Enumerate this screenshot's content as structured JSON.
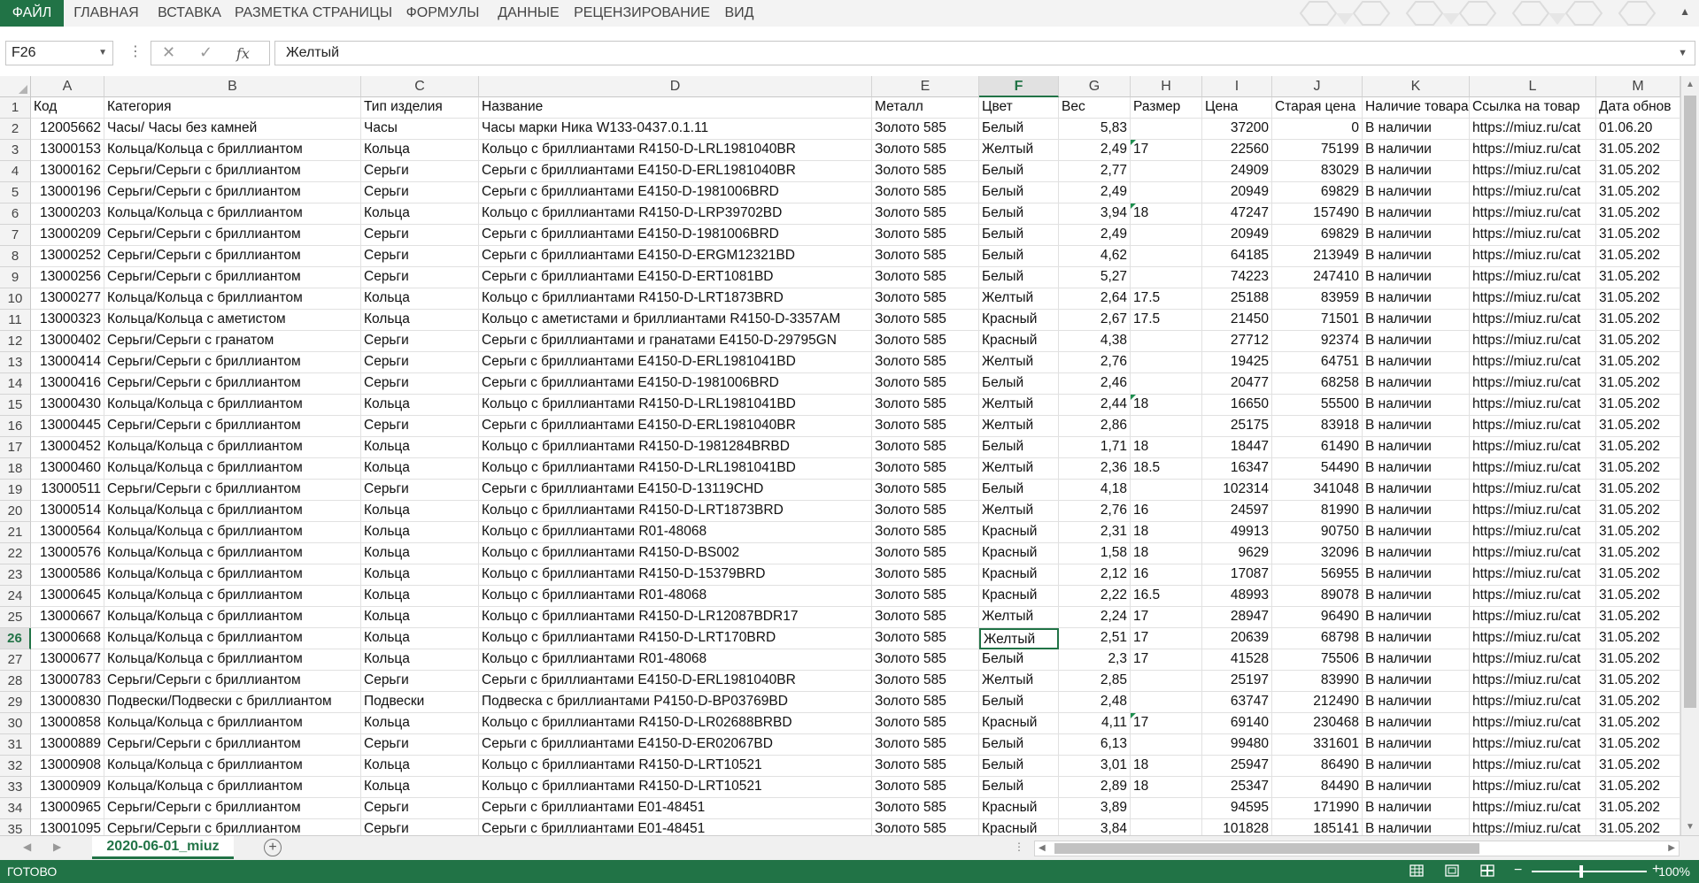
{
  "ribbon": {
    "tabs": [
      "ФАЙЛ",
      "ГЛАВНАЯ",
      "ВСТАВКА",
      "РАЗМЕТКА СТРАНИЦЫ",
      "ФОРМУЛЫ",
      "ДАННЫЕ",
      "РЕЦЕНЗИРОВАНИЕ",
      "ВИД"
    ]
  },
  "formula_bar": {
    "name_box": "F26",
    "fx_label": "fx",
    "content": "Желтый"
  },
  "grid": {
    "columns": [
      "A",
      "B",
      "C",
      "D",
      "E",
      "F",
      "G",
      "H",
      "I",
      "J",
      "K",
      "L",
      "M"
    ],
    "active_column": "F",
    "active_row": 26,
    "rows": [
      {
        "n": "1",
        "cells": [
          "Код",
          "Категория",
          "Тип изделия",
          "Название",
          "Металл",
          "Цвет",
          "Вес",
          "Размер",
          "Цена",
          "Старая цена",
          "Наличие товара",
          "Ссылка на товар",
          "Дата обнов"
        ]
      },
      {
        "n": "2",
        "cells": [
          "12005662",
          "Часы/ Часы без камней",
          "Часы",
          "Часы марки Ника W133-0437.0.1.11",
          "Золото 585",
          "Белый",
          "5,83",
          "",
          "37200",
          "0",
          "В наличии",
          "https://miuz.ru/cat",
          "01.06.20"
        ]
      },
      {
        "n": "3",
        "cells": [
          "13000153",
          "Кольца/Кольца с бриллиантом",
          "Кольца",
          "Кольцо с бриллиантами R4150-D-LRL1981040BR",
          "Золото 585",
          "Желтый",
          "2,49",
          "17",
          "22560",
          "75199",
          "В наличии",
          "https://miuz.ru/cat",
          "31.05.202"
        ]
      },
      {
        "n": "4",
        "cells": [
          "13000162",
          "Серьги/Серьги с бриллиантом",
          "Серьги",
          "Серьги с бриллиантами E4150-D-ERL1981040BR",
          "Золото 585",
          "Белый",
          "2,77",
          "",
          "24909",
          "83029",
          "В наличии",
          "https://miuz.ru/cat",
          "31.05.202"
        ]
      },
      {
        "n": "5",
        "cells": [
          "13000196",
          "Серьги/Серьги с бриллиантом",
          "Серьги",
          "Серьги с бриллиантами E4150-D-1981006BRD",
          "Золото 585",
          "Белый",
          "2,49",
          "",
          "20949",
          "69829",
          "В наличии",
          "https://miuz.ru/cat",
          "31.05.202"
        ]
      },
      {
        "n": "6",
        "cells": [
          "13000203",
          "Кольца/Кольца с бриллиантом",
          "Кольца",
          "Кольцо с бриллиантами R4150-D-LRP39702BD",
          "Золото 585",
          "Белый",
          "3,94",
          "18",
          "47247",
          "157490",
          "В наличии",
          "https://miuz.ru/cat",
          "31.05.202"
        ]
      },
      {
        "n": "7",
        "cells": [
          "13000209",
          "Серьги/Серьги с бриллиантом",
          "Серьги",
          "Серьги с бриллиантами E4150-D-1981006BRD",
          "Золото 585",
          "Белый",
          "2,49",
          "",
          "20949",
          "69829",
          "В наличии",
          "https://miuz.ru/cat",
          "31.05.202"
        ]
      },
      {
        "n": "8",
        "cells": [
          "13000252",
          "Серьги/Серьги с бриллиантом",
          "Серьги",
          "Серьги с бриллиантами E4150-D-ERGM12321BD",
          "Золото 585",
          "Белый",
          "4,62",
          "",
          "64185",
          "213949",
          "В наличии",
          "https://miuz.ru/cat",
          "31.05.202"
        ]
      },
      {
        "n": "9",
        "cells": [
          "13000256",
          "Серьги/Серьги с бриллиантом",
          "Серьги",
          "Серьги с бриллиантами E4150-D-ERT1081BD",
          "Золото 585",
          "Белый",
          "5,27",
          "",
          "74223",
          "247410",
          "В наличии",
          "https://miuz.ru/cat",
          "31.05.202"
        ]
      },
      {
        "n": "10",
        "cells": [
          "13000277",
          "Кольца/Кольца с бриллиантом",
          "Кольца",
          "Кольцо с бриллиантами R4150-D-LRT1873BRD",
          "Золото 585",
          "Желтый",
          "2,64",
          "17.5",
          "25188",
          "83959",
          "В наличии",
          "https://miuz.ru/cat",
          "31.05.202"
        ]
      },
      {
        "n": "11",
        "cells": [
          "13000323",
          "Кольца/Кольца с аметистом",
          "Кольца",
          "Кольцо с аметистами и бриллиантами R4150-D-3357AM",
          "Золото 585",
          "Красный",
          "2,67",
          "17.5",
          "21450",
          "71501",
          "В наличии",
          "https://miuz.ru/cat",
          "31.05.202"
        ]
      },
      {
        "n": "12",
        "cells": [
          "13000402",
          "Серьги/Серьги с гранатом",
          "Серьги",
          "Серьги с бриллиантами и гранатами E4150-D-29795GN",
          "Золото 585",
          "Красный",
          "4,38",
          "",
          "27712",
          "92374",
          "В наличии",
          "https://miuz.ru/cat",
          "31.05.202"
        ]
      },
      {
        "n": "13",
        "cells": [
          "13000414",
          "Серьги/Серьги с бриллиантом",
          "Серьги",
          "Серьги с бриллиантами E4150-D-ERL1981041BD",
          "Золото 585",
          "Желтый",
          "2,76",
          "",
          "19425",
          "64751",
          "В наличии",
          "https://miuz.ru/cat",
          "31.05.202"
        ]
      },
      {
        "n": "14",
        "cells": [
          "13000416",
          "Серьги/Серьги с бриллиантом",
          "Серьги",
          "Серьги с бриллиантами E4150-D-1981006BRD",
          "Золото 585",
          "Белый",
          "2,46",
          "",
          "20477",
          "68258",
          "В наличии",
          "https://miuz.ru/cat",
          "31.05.202"
        ]
      },
      {
        "n": "15",
        "cells": [
          "13000430",
          "Кольца/Кольца с бриллиантом",
          "Кольца",
          "Кольцо с бриллиантами R4150-D-LRL1981041BD",
          "Золото 585",
          "Желтый",
          "2,44",
          "18",
          "16650",
          "55500",
          "В наличии",
          "https://miuz.ru/cat",
          "31.05.202"
        ]
      },
      {
        "n": "16",
        "cells": [
          "13000445",
          "Серьги/Серьги с бриллиантом",
          "Серьги",
          "Серьги с бриллиантами E4150-D-ERL1981040BR",
          "Золото 585",
          "Желтый",
          "2,86",
          "",
          "25175",
          "83918",
          "В наличии",
          "https://miuz.ru/cat",
          "31.05.202"
        ]
      },
      {
        "n": "17",
        "cells": [
          "13000452",
          "Кольца/Кольца с бриллиантом",
          "Кольца",
          "Кольцо с бриллиантами R4150-D-1981284BRBD",
          "Золото 585",
          "Белый",
          "1,71",
          "18",
          "18447",
          "61490",
          "В наличии",
          "https://miuz.ru/cat",
          "31.05.202"
        ]
      },
      {
        "n": "18",
        "cells": [
          "13000460",
          "Кольца/Кольца с бриллиантом",
          "Кольца",
          "Кольцо с бриллиантами R4150-D-LRL1981041BD",
          "Золото 585",
          "Желтый",
          "2,36",
          "18.5",
          "16347",
          "54490",
          "В наличии",
          "https://miuz.ru/cat",
          "31.05.202"
        ]
      },
      {
        "n": "19",
        "cells": [
          "13000511",
          "Серьги/Серьги с бриллиантом",
          "Серьги",
          "Серьги с бриллиантами E4150-D-13119CHD",
          "Золото 585",
          "Белый",
          "4,18",
          "",
          "102314",
          "341048",
          "В наличии",
          "https://miuz.ru/cat",
          "31.05.202"
        ]
      },
      {
        "n": "20",
        "cells": [
          "13000514",
          "Кольца/Кольца с бриллиантом",
          "Кольца",
          "Кольцо с бриллиантами R4150-D-LRT1873BRD",
          "Золото 585",
          "Желтый",
          "2,76",
          "16",
          "24597",
          "81990",
          "В наличии",
          "https://miuz.ru/cat",
          "31.05.202"
        ]
      },
      {
        "n": "21",
        "cells": [
          "13000564",
          "Кольца/Кольца с бриллиантом",
          "Кольца",
          "Кольцо с бриллиантами R01-48068",
          "Золото 585",
          "Красный",
          "2,31",
          "18",
          "49913",
          "90750",
          "В наличии",
          "https://miuz.ru/cat",
          "31.05.202"
        ]
      },
      {
        "n": "22",
        "cells": [
          "13000576",
          "Кольца/Кольца с бриллиантом",
          "Кольца",
          "Кольцо с бриллиантами R4150-D-BS002",
          "Золото 585",
          "Красный",
          "1,58",
          "18",
          "9629",
          "32096",
          "В наличии",
          "https://miuz.ru/cat",
          "31.05.202"
        ]
      },
      {
        "n": "23",
        "cells": [
          "13000586",
          "Кольца/Кольца с бриллиантом",
          "Кольца",
          "Кольцо с бриллиантами R4150-D-15379BRD",
          "Золото 585",
          "Красный",
          "2,12",
          "16",
          "17087",
          "56955",
          "В наличии",
          "https://miuz.ru/cat",
          "31.05.202"
        ]
      },
      {
        "n": "24",
        "cells": [
          "13000645",
          "Кольца/Кольца с бриллиантом",
          "Кольца",
          "Кольцо с бриллиантами R01-48068",
          "Золото 585",
          "Красный",
          "2,22",
          "16.5",
          "48993",
          "89078",
          "В наличии",
          "https://miuz.ru/cat",
          "31.05.202"
        ]
      },
      {
        "n": "25",
        "cells": [
          "13000667",
          "Кольца/Кольца с бриллиантом",
          "Кольца",
          "Кольцо с бриллиантами R4150-D-LR12087BDR17",
          "Золото 585",
          "Желтый",
          "2,24",
          "17",
          "28947",
          "96490",
          "В наличии",
          "https://miuz.ru/cat",
          "31.05.202"
        ]
      },
      {
        "n": "26",
        "cells": [
          "13000668",
          "Кольца/Кольца с бриллиантом",
          "Кольца",
          "Кольцо с бриллиантами R4150-D-LRT170BRD",
          "Золото 585",
          "Желтый",
          "2,51",
          "17",
          "20639",
          "68798",
          "В наличии",
          "https://miuz.ru/cat",
          "31.05.202"
        ]
      },
      {
        "n": "27",
        "cells": [
          "13000677",
          "Кольца/Кольца с бриллиантом",
          "Кольца",
          "Кольцо с бриллиантами R01-48068",
          "Золото 585",
          "Белый",
          "2,3",
          "17",
          "41528",
          "75506",
          "В наличии",
          "https://miuz.ru/cat",
          "31.05.202"
        ]
      },
      {
        "n": "28",
        "cells": [
          "13000783",
          "Серьги/Серьги с бриллиантом",
          "Серьги",
          "Серьги с бриллиантами E4150-D-ERL1981040BR",
          "Золото 585",
          "Желтый",
          "2,85",
          "",
          "25197",
          "83990",
          "В наличии",
          "https://miuz.ru/cat",
          "31.05.202"
        ]
      },
      {
        "n": "29",
        "cells": [
          "13000830",
          "Подвески/Подвески с бриллиантом",
          "Подвески",
          "Подвеска с бриллиантами P4150-D-BP03769BD",
          "Золото 585",
          "Белый",
          "2,48",
          "",
          "63747",
          "212490",
          "В наличии",
          "https://miuz.ru/cat",
          "31.05.202"
        ]
      },
      {
        "n": "30",
        "cells": [
          "13000858",
          "Кольца/Кольца с бриллиантом",
          "Кольца",
          "Кольцо с бриллиантами R4150-D-LR02688BRBD",
          "Золото 585",
          "Красный",
          "4,11",
          "17",
          "69140",
          "230468",
          "В наличии",
          "https://miuz.ru/cat",
          "31.05.202"
        ]
      },
      {
        "n": "31",
        "cells": [
          "13000889",
          "Серьги/Серьги с бриллиантом",
          "Серьги",
          "Серьги с бриллиантами E4150-D-ER02067BD",
          "Золото 585",
          "Белый",
          "6,13",
          "",
          "99480",
          "331601",
          "В наличии",
          "https://miuz.ru/cat",
          "31.05.202"
        ]
      },
      {
        "n": "32",
        "cells": [
          "13000908",
          "Кольца/Кольца с бриллиантом",
          "Кольца",
          "Кольцо с бриллиантами R4150-D-LRT10521",
          "Золото 585",
          "Белый",
          "3,01",
          "18",
          "25947",
          "86490",
          "В наличии",
          "https://miuz.ru/cat",
          "31.05.202"
        ]
      },
      {
        "n": "33",
        "cells": [
          "13000909",
          "Кольца/Кольца с бриллиантом",
          "Кольца",
          "Кольцо с бриллиантами R4150-D-LRT10521",
          "Золото 585",
          "Белый",
          "2,89",
          "18",
          "25347",
          "84490",
          "В наличии",
          "https://miuz.ru/cat",
          "31.05.202"
        ]
      },
      {
        "n": "34",
        "cells": [
          "13000965",
          "Серьги/Серьги с бриллиантом",
          "Серьги",
          "Серьги с бриллиантами E01-48451",
          "Золото 585",
          "Красный",
          "3,89",
          "",
          "94595",
          "171990",
          "В наличии",
          "https://miuz.ru/cat",
          "31.05.202"
        ]
      },
      {
        "n": "35",
        "cells": [
          "13001095",
          "Серьги/Серьги с бриллиантом",
          "Серьги",
          "Серьги с бриллиантами E01-48451",
          "Золото 585",
          "Красный",
          "3,84",
          "",
          "101828",
          "185141",
          "В наличии",
          "https://miuz.ru/cat",
          "31.05.202"
        ]
      }
    ]
  },
  "sheets": {
    "active": "2020-06-01_miuz",
    "add_label": "+"
  },
  "status_bar": {
    "ready": "ГОТОВО",
    "zoom": "100%"
  },
  "colors": {
    "accent": "#217346",
    "gridline": "#e1e1e1",
    "header_bg": "#f3f3f3"
  },
  "icons": [
    "close-icon",
    "check-icon",
    "fx-icon",
    "chevron-down-icon",
    "plus-icon",
    "normal-view-icon",
    "page-layout-icon",
    "page-break-icon",
    "zoom-minus-icon",
    "zoom-plus-icon"
  ]
}
